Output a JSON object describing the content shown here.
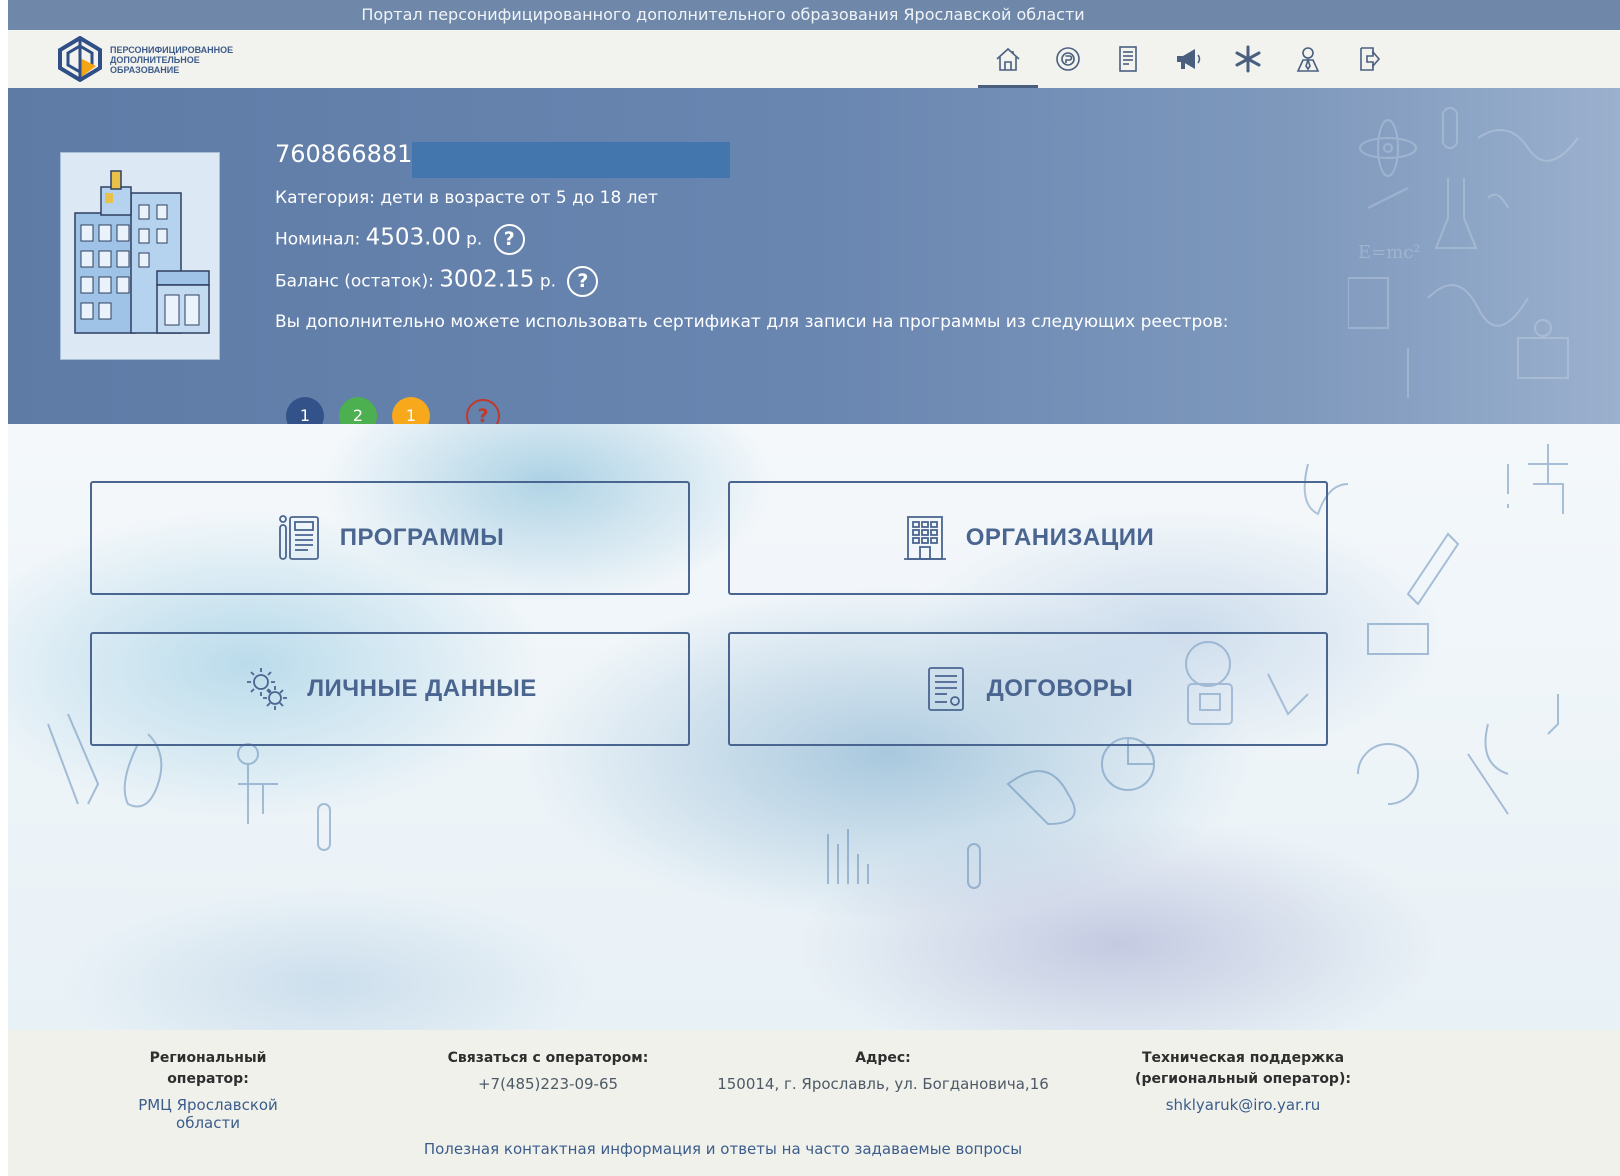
{
  "portal_title": "Портал персонифицированного дополнительного образования Ярославской области",
  "logo": {
    "line1": "ПЕРСОНИФИЦИРОВАННОЕ",
    "line2": "ДОПОЛНИТЕЛЬНОЕ",
    "line3": "ОБРАЗОВАНИЕ"
  },
  "nav": [
    {
      "icon": "home-icon",
      "active": true
    },
    {
      "icon": "coin-icon",
      "active": false
    },
    {
      "icon": "document-list-icon",
      "active": false
    },
    {
      "icon": "megaphone-icon",
      "active": false
    },
    {
      "icon": "star-burst-icon",
      "active": false
    },
    {
      "icon": "user-icon",
      "active": false
    },
    {
      "icon": "logout-icon",
      "active": false
    }
  ],
  "profile": {
    "certificate_number": "7608668814",
    "category_label": "Категория:",
    "category_value": "дети в возрасте от 5 до 18 лет",
    "nominal_label": "Номинал:",
    "nominal_value": "4503.00",
    "balance_label": "Баланс (остаток):",
    "balance_value": "3002.15",
    "currency": "р.",
    "help_mark": "?",
    "registers_text": "Вы дополнительно можете использовать сертификат для записи на программы из следующих реестров:",
    "registers": [
      {
        "value": "1",
        "color": "#34528a"
      },
      {
        "value": "2",
        "color": "#4caf50"
      },
      {
        "value": "1",
        "color": "#f7a81b"
      }
    ],
    "registers_help": "?"
  },
  "tiles": {
    "programs": "ПРОГРАММЫ",
    "organizations": "ОРГАНИЗАЦИИ",
    "personal_data": "ЛИЧНЫЕ ДАННЫЕ",
    "contracts": "ДОГОВОРЫ"
  },
  "footer": {
    "operator_title": "Региональный оператор:",
    "operator_value": "РМЦ Ярославской области",
    "contact_title": "Связаться с оператором:",
    "contact_value": "+7(485)223-09-65",
    "address_title": "Адрес:",
    "address_value": "150014, г. Ярославль, ул. Богдановича,16",
    "support_title_line1": "Техническая поддержка",
    "support_title_line2": "(региональный оператор):",
    "support_value": "shklyaruk@iro.yar.ru",
    "faq_link": "Полезная контактная информация и ответы на часто задаваемые вопросы"
  }
}
